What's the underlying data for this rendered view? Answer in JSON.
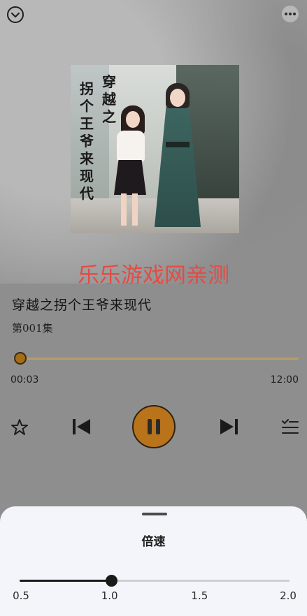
{
  "book": {
    "title": "穿越之拐个王爷来现代",
    "cover_col_1": "穿越之",
    "cover_col_2": "拐个王爷来现代",
    "episode": "第001集"
  },
  "watermark": "乐乐游戏网亲测",
  "player": {
    "current_time": "00:03",
    "total_time": "12:00",
    "progress": 0.004,
    "state": "playing"
  },
  "icons": {
    "collapse": "chevron-down-icon",
    "more": "more-dots-icon",
    "favorite": "star-icon",
    "previous": "skip-previous-icon",
    "pause": "pause-icon",
    "next": "skip-next-icon",
    "playlist": "playlist-icon"
  },
  "speed_sheet": {
    "title": "倍速",
    "options": [
      "0.5",
      "1.0",
      "1.5",
      "2.0"
    ],
    "selected": "1.0",
    "selected_fraction": 0.333
  },
  "colors": {
    "accent": "#b8731b",
    "watermark": "#e44b44",
    "sheet_bg": "#f4f5fa"
  }
}
